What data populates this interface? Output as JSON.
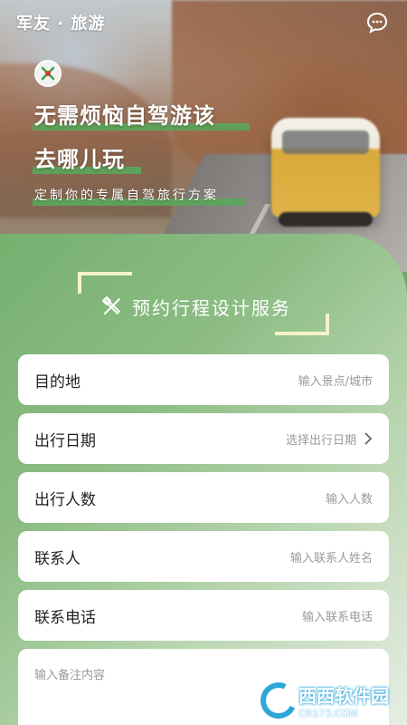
{
  "header": {
    "brand": "军友 · 旅游",
    "chat_icon": "chat-bubble-icon",
    "logo_icon": "brand-logo-icon"
  },
  "hero": {
    "headline_line1": "无需烦恼自驾游该",
    "headline_line2": "去哪儿玩",
    "subline": "定制你的专属自驾旅行方案"
  },
  "section": {
    "title": "预约行程设计服务",
    "icon": "design-tool-icon"
  },
  "form": {
    "fields": [
      {
        "label": "目的地",
        "placeholder": "输入景点/城市"
      },
      {
        "label": "出行日期",
        "placeholder": "选择出行日期"
      },
      {
        "label": "出行人数",
        "placeholder": "输入人数"
      },
      {
        "label": "联系人",
        "placeholder": "输入联系人姓名"
      },
      {
        "label": "联系电话",
        "placeholder": "输入联系电话"
      }
    ],
    "notes_placeholder": "输入备注内容"
  },
  "watermark": {
    "text": "西西软件园",
    "sub": "CR173.COM"
  },
  "colors": {
    "accent_green": "#5aa75a",
    "bracket": "#f6f3c9",
    "panel_start": "#76b06f"
  }
}
